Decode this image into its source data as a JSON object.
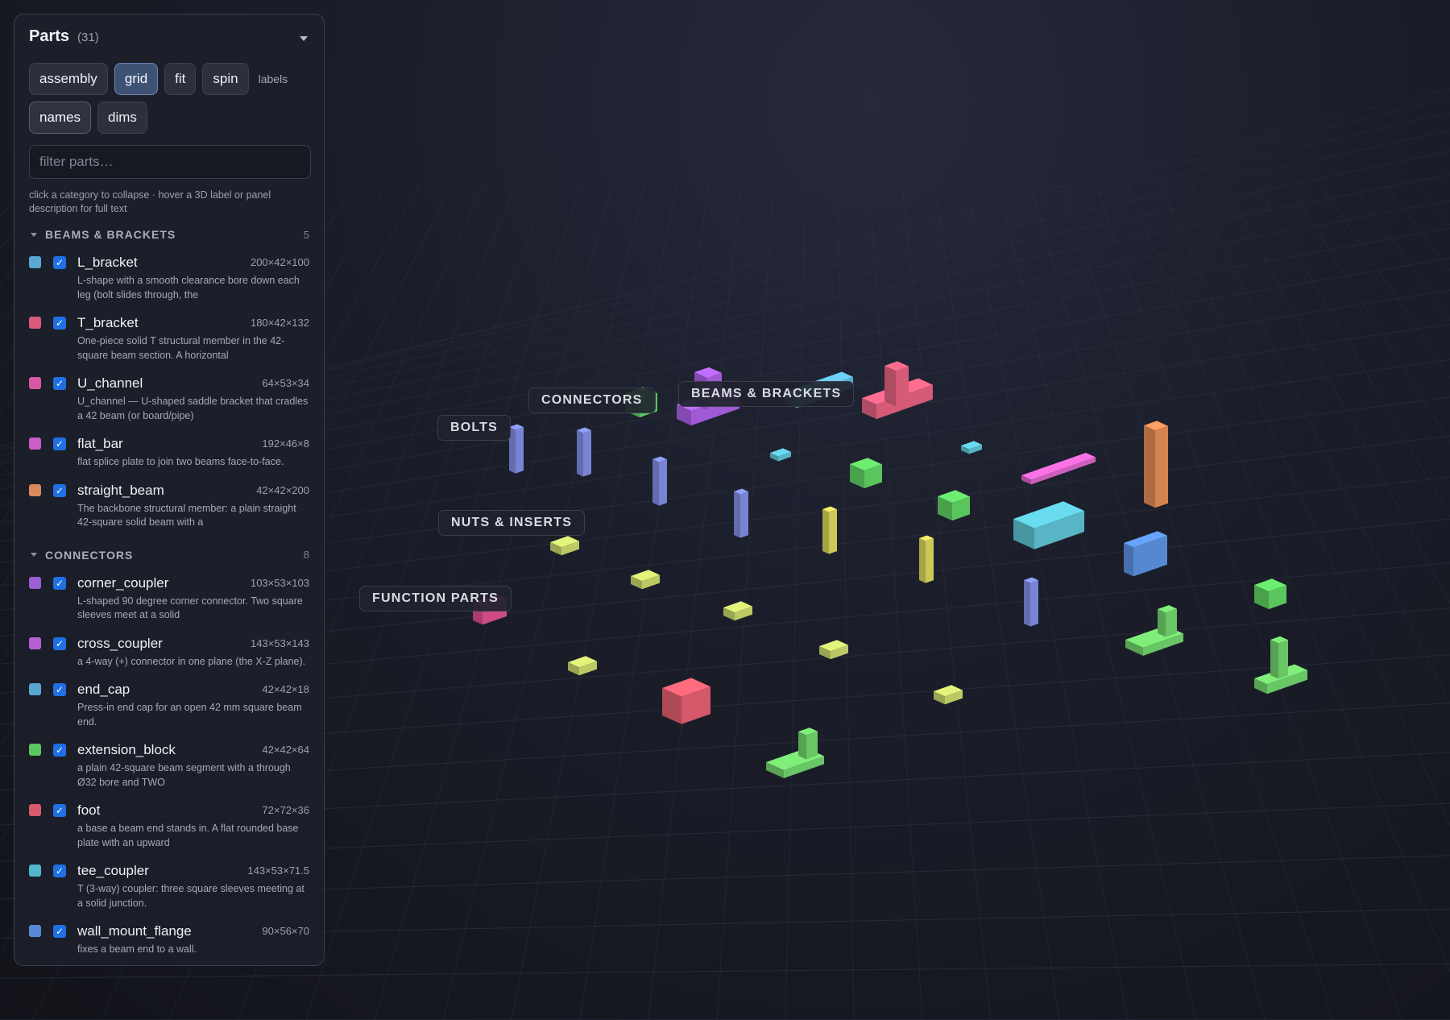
{
  "panel": {
    "title": "Parts",
    "count": "(31)",
    "buttons": {
      "assembly": "assembly",
      "grid": "grid",
      "fit": "fit",
      "spin": "spin",
      "names": "names",
      "dims": "dims"
    },
    "labels_text": "labels",
    "active_view": "grid",
    "filter_placeholder": "filter parts…",
    "hint": "click a category to collapse · hover a 3D label or panel description for full text"
  },
  "categories": [
    {
      "name": "BEAMS & BRACKETS",
      "count": "5",
      "parts": [
        {
          "color": "#59a9d3",
          "name": "L_bracket",
          "dims": "200×42×100",
          "desc": "L-shape with a smooth clearance bore down each leg (bolt slides through, the",
          "checked": true
        },
        {
          "color": "#d95a7c",
          "name": "T_bracket",
          "dims": "180×42×132",
          "desc": "One-piece solid T structural member in the 42-square beam section. A horizontal",
          "checked": true
        },
        {
          "color": "#d957a4",
          "name": "U_channel",
          "dims": "64×53×34",
          "desc": "U_channel — U-shaped saddle bracket that cradles a 42 beam (or board/pipe)",
          "checked": true
        },
        {
          "color": "#cc5cc8",
          "name": "flat_bar",
          "dims": "192×46×8",
          "desc": "flat splice plate to join two beams face-to-face.",
          "checked": true
        },
        {
          "color": "#d98a5e",
          "name": "straight_beam",
          "dims": "42×42×200",
          "desc": "The backbone structural member: a plain straight 42-square solid beam with a",
          "checked": true
        }
      ]
    },
    {
      "name": "CONNECTORS",
      "count": "8",
      "parts": [
        {
          "color": "#9a5fd1",
          "name": "corner_coupler",
          "dims": "103×53×103",
          "desc": "L-shaped 90 degree corner connector. Two square sleeves meet at a solid",
          "checked": true
        },
        {
          "color": "#b760d6",
          "name": "cross_coupler",
          "dims": "143×53×143",
          "desc": "a 4-way (+) connector in one plane (the X-Z plane).",
          "checked": true
        },
        {
          "color": "#5aa6cf",
          "name": "end_cap",
          "dims": "42×42×18",
          "desc": "Press-in end cap for an open 42 mm square beam end.",
          "checked": true
        },
        {
          "color": "#5cc75e",
          "name": "extension_block",
          "dims": "42×42×64",
          "desc": "a plain 42-square beam segment with a through Ø32 bore and TWO",
          "checked": true
        },
        {
          "color": "#d95a6c",
          "name": "foot",
          "dims": "72×72×36",
          "desc": "a base a beam end stands in. A flat rounded base plate with an upward",
          "checked": true
        },
        {
          "color": "#52b5cc",
          "name": "tee_coupler",
          "dims": "143×53×71.5",
          "desc": "T (3-way) coupler: three square sleeves meeting at a solid junction.",
          "checked": true
        },
        {
          "color": "#5b88d6",
          "name": "wall_mount_flange",
          "dims": "90×56×70",
          "desc": "fixes a beam end to a wall.",
          "checked": true
        }
      ]
    }
  ],
  "scene_labels": {
    "beams": "BEAMS & BRACKETS",
    "connectors": "CONNECTORS",
    "bolts": "BOLTS",
    "nuts": "NUTS & INSERTS",
    "functions": "FUNCTION PARTS"
  },
  "scene_parts": [
    {
      "icon": "tall-beam-part-icon",
      "color": "#e08a55"
    },
    {
      "icon": "t-bracket-part-icon",
      "color": "#e0607e"
    },
    {
      "icon": "l-bracket-part-icon",
      "color": "#5fb6d8"
    },
    {
      "icon": "cross-coupler-part-icon",
      "color": "#a85fe0"
    },
    {
      "icon": "corner-coupler-part-icon",
      "color": "#9a62d6"
    },
    {
      "icon": "flat-bar-part-icon",
      "color": "#d964c8"
    },
    {
      "icon": "u-channel-part-icon",
      "color": "#e0528a"
    },
    {
      "icon": "tee-coupler-part-icon",
      "color": "#5cbfd0"
    },
    {
      "icon": "wall-flange-part-icon",
      "color": "#5a8fdc"
    },
    {
      "icon": "extension-block-part-icon",
      "color": "#5fcf62"
    },
    {
      "icon": "foot-part-icon",
      "color": "#e25b6d"
    },
    {
      "icon": "bolt-part-icon",
      "color": "#7f8be0"
    },
    {
      "icon": "hook-part-icon",
      "color": "#d6d25a"
    },
    {
      "icon": "nut-part-icon",
      "color": "#e0836a"
    },
    {
      "icon": "hinge-part-icon",
      "color": "#6fd06a"
    },
    {
      "icon": "clamp-part-icon",
      "color": "#e05e6e"
    }
  ]
}
